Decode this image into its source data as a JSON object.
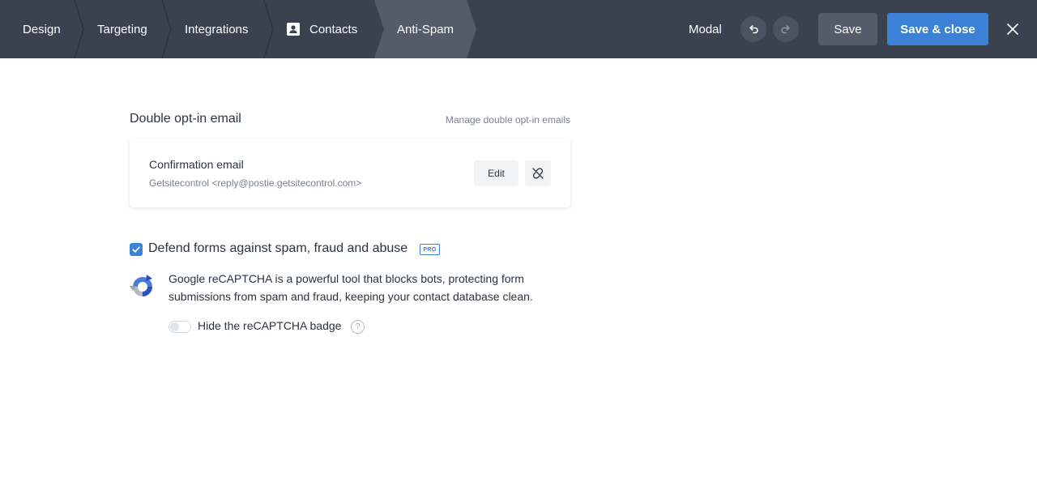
{
  "header": {
    "steps": [
      {
        "label": "Design"
      },
      {
        "label": "Targeting"
      },
      {
        "label": "Integrations"
      },
      {
        "label": "Contacts",
        "icon": "contact-card-icon"
      },
      {
        "label": "Anti-Spam",
        "active": true
      }
    ],
    "mode_label": "Modal",
    "undo_icon": "undo-icon",
    "redo_icon": "redo-icon",
    "save_label": "Save",
    "save_close_label": "Save & close",
    "close_icon": "close-icon"
  },
  "double_optin": {
    "title": "Double opt-in email",
    "manage_link": "Manage double opt-in emails",
    "email": {
      "title": "Confirmation email",
      "from": "Getsitecontrol <reply@postie.getsitecontrol.com>",
      "edit_label": "Edit",
      "unlink_icon": "unlink-icon"
    }
  },
  "antispam": {
    "checkbox_checked": true,
    "label": "Defend forms against spam, fraud and abuse",
    "badge": "PRO",
    "description": "Google reCAPTCHA is a powerful tool that blocks bots, protecting form submissions from spam and fraud, keeping your contact database clean.",
    "hide_badge_label": "Hide the reCAPTCHA badge",
    "hide_badge_enabled": false,
    "help_glyph": "?"
  },
  "colors": {
    "topbar": "#3a4250",
    "active_step": "#545c69",
    "accent": "#3b82d6"
  }
}
